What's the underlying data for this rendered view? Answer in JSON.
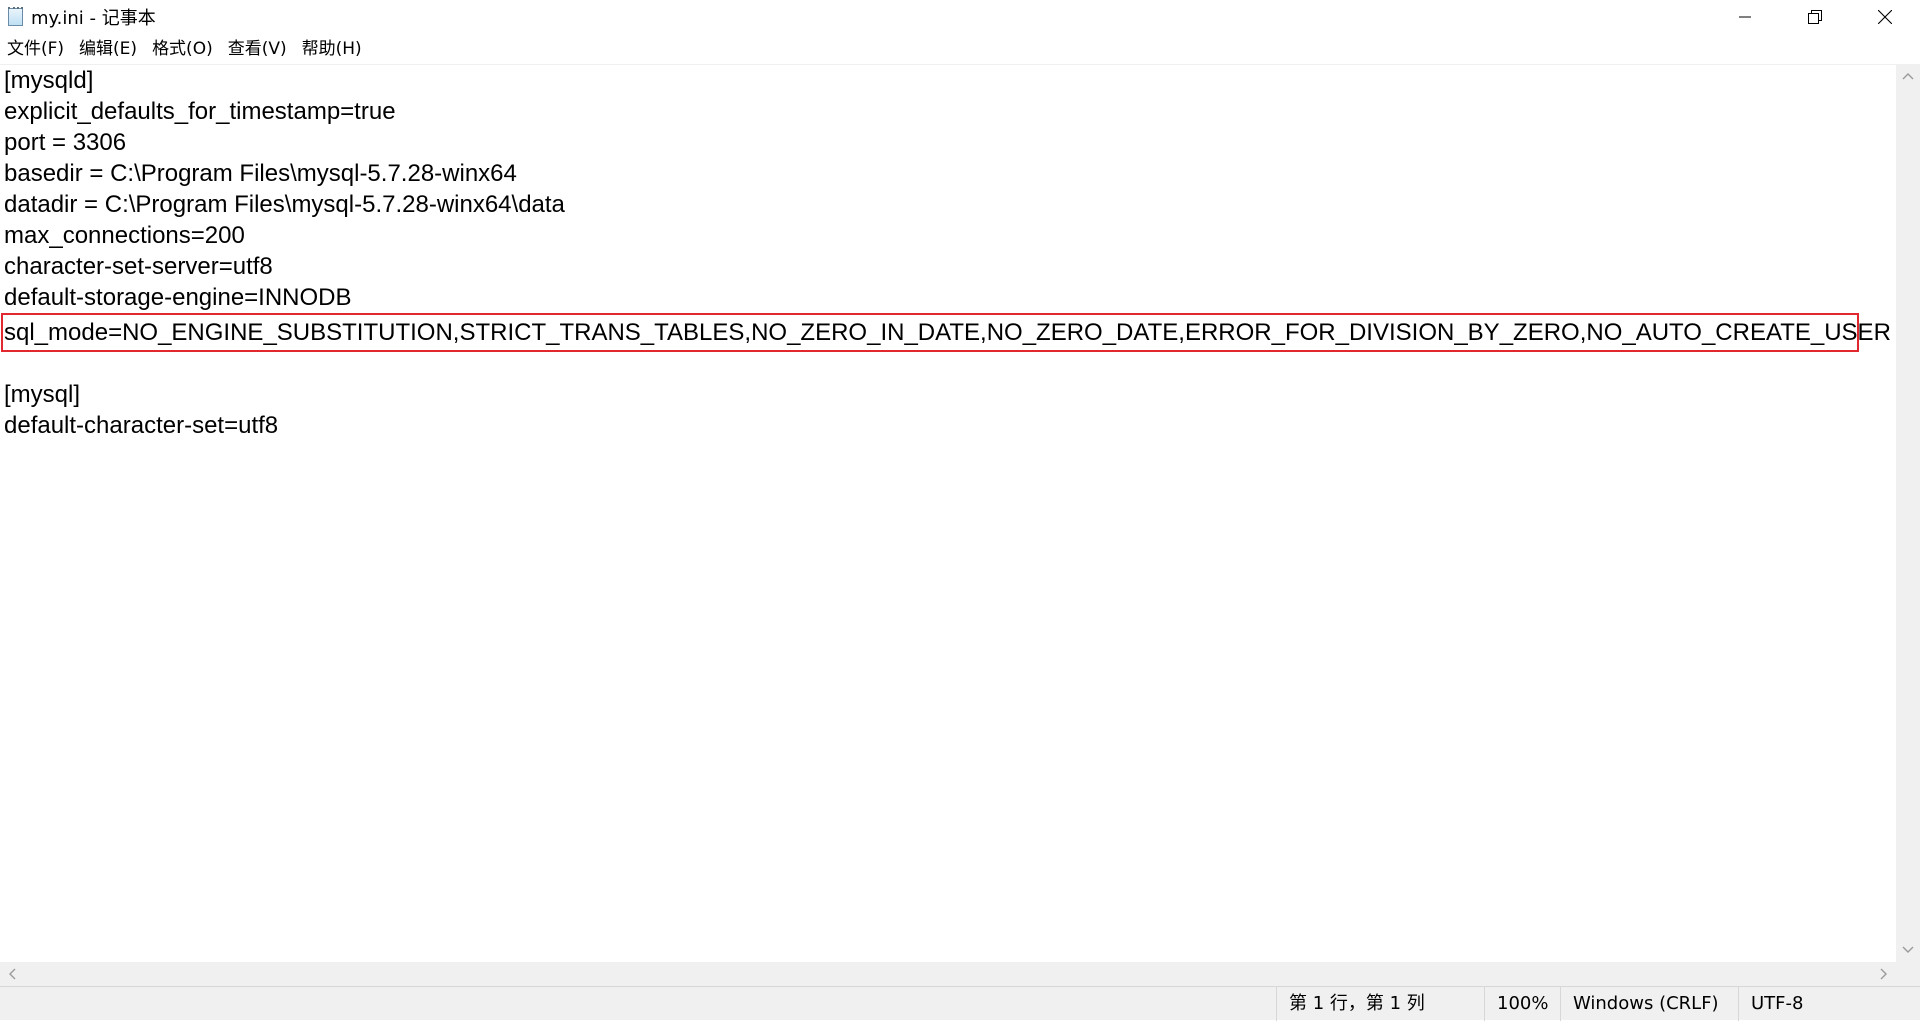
{
  "window": {
    "title": "my.ini - 记事本"
  },
  "menu": {
    "items": [
      {
        "label": "文件(F)"
      },
      {
        "label": "编辑(E)"
      },
      {
        "label": "格式(O)"
      },
      {
        "label": "查看(V)"
      },
      {
        "label": "帮助(H)"
      }
    ]
  },
  "editor": {
    "lines": [
      "[mysqld]",
      "explicit_defaults_for_timestamp=true",
      "port = 3306",
      "basedir = C:\\Program Files\\mysql-5.7.28-winx64",
      "datadir = C:\\Program Files\\mysql-5.7.28-winx64\\data",
      "max_connections=200",
      "character-set-server=utf8",
      "default-storage-engine=INNODB",
      "sql_mode=NO_ENGINE_SUBSTITUTION,STRICT_TRANS_TABLES,NO_ZERO_IN_DATE,NO_ZERO_DATE,ERROR_FOR_DIVISION_BY_ZERO,NO_AUTO_CREATE_USER",
      "",
      "[mysql]",
      "default-character-set=utf8"
    ],
    "highlighted_line_index": 8,
    "highlight_color": "#e0282e"
  },
  "status": {
    "position": "第 1 行，第 1 列",
    "zoom": "100%",
    "line_ending": "Windows (CRLF)",
    "encoding": "UTF-8"
  },
  "icons": {
    "app": "notepad-icon",
    "minimize": "minimize-icon",
    "maximize": "restore-icon",
    "close": "close-icon"
  }
}
